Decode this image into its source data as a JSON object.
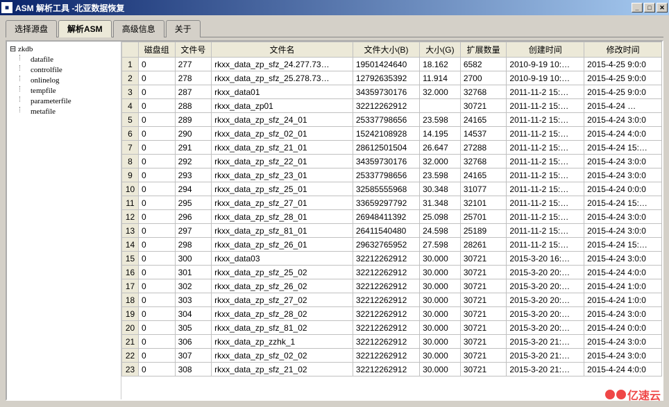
{
  "window": {
    "title": "ASM 解析工具 -北亚数据恢复"
  },
  "tabs": [
    {
      "label": "选择源盘"
    },
    {
      "label": "解析ASM"
    },
    {
      "label": "高级信息"
    },
    {
      "label": "关于"
    }
  ],
  "active_tab_index": 1,
  "tree": {
    "root": "zkdb",
    "children": [
      "datafile",
      "controlfile",
      "onlinelog",
      "tempfile",
      "parameterfile",
      "metafile"
    ]
  },
  "table": {
    "columns": [
      "磁盘组",
      "文件号",
      "文件名",
      "文件大小(B)",
      "大小(G)",
      "扩展数量",
      "创建时间",
      "修改时间"
    ],
    "rows": [
      {
        "n": 1,
        "dg": "0",
        "fno": "277",
        "fname": "rkxx_data_zp_sfz_24.277.73…",
        "fsize": "19501424640",
        "gb": "18.162",
        "ext": "6582",
        "ct": "2010-9-19 10:…",
        "mt": "2015-4-25 9:0:0"
      },
      {
        "n": 2,
        "dg": "0",
        "fno": "278",
        "fname": "rkxx_data_zp_sfz_25.278.73…",
        "fsize": "12792635392",
        "gb": "11.914",
        "ext": "2700",
        "ct": "2010-9-19 10:…",
        "mt": "2015-4-25 9:0:0"
      },
      {
        "n": 3,
        "dg": "0",
        "fno": "287",
        "fname": "rkxx_data01",
        "fsize": "34359730176",
        "gb": "32.000",
        "ext": "32768",
        "ct": "2011-11-2 15:…",
        "mt": "2015-4-25 9:0:0"
      },
      {
        "n": 4,
        "dg": "0",
        "fno": "288",
        "fname": "rkxx_data_zp01",
        "fsize": "32212262912",
        "gb": "",
        "ext": "30721",
        "ct": "2011-11-2 15:…",
        "mt": "2015-4-24 …"
      },
      {
        "n": 5,
        "dg": "0",
        "fno": "289",
        "fname": "rkxx_data_zp_sfz_24_01",
        "fsize": "25337798656",
        "gb": "23.598",
        "ext": "24165",
        "ct": "2011-11-2 15:…",
        "mt": "2015-4-24 3:0:0"
      },
      {
        "n": 6,
        "dg": "0",
        "fno": "290",
        "fname": "rkxx_data_zp_sfz_02_01",
        "fsize": "15242108928",
        "gb": "14.195",
        "ext": "14537",
        "ct": "2011-11-2 15:…",
        "mt": "2015-4-24 4:0:0"
      },
      {
        "n": 7,
        "dg": "0",
        "fno": "291",
        "fname": "rkxx_data_zp_sfz_21_01",
        "fsize": "28612501504",
        "gb": "26.647",
        "ext": "27288",
        "ct": "2011-11-2 15:…",
        "mt": "2015-4-24 15:…"
      },
      {
        "n": 8,
        "dg": "0",
        "fno": "292",
        "fname": "rkxx_data_zp_sfz_22_01",
        "fsize": "34359730176",
        "gb": "32.000",
        "ext": "32768",
        "ct": "2011-11-2 15:…",
        "mt": "2015-4-24 3:0:0"
      },
      {
        "n": 9,
        "dg": "0",
        "fno": "293",
        "fname": "rkxx_data_zp_sfz_23_01",
        "fsize": "25337798656",
        "gb": "23.598",
        "ext": "24165",
        "ct": "2011-11-2 15:…",
        "mt": "2015-4-24 3:0:0"
      },
      {
        "n": 10,
        "dg": "0",
        "fno": "294",
        "fname": "rkxx_data_zp_sfz_25_01",
        "fsize": "32585555968",
        "gb": "30.348",
        "ext": "31077",
        "ct": "2011-11-2 15:…",
        "mt": "2015-4-24 0:0:0"
      },
      {
        "n": 11,
        "dg": "0",
        "fno": "295",
        "fname": "rkxx_data_zp_sfz_27_01",
        "fsize": "33659297792",
        "gb": "31.348",
        "ext": "32101",
        "ct": "2011-11-2 15:…",
        "mt": "2015-4-24 15:…"
      },
      {
        "n": 12,
        "dg": "0",
        "fno": "296",
        "fname": "rkxx_data_zp_sfz_28_01",
        "fsize": "26948411392",
        "gb": "25.098",
        "ext": "25701",
        "ct": "2011-11-2 15:…",
        "mt": "2015-4-24 3:0:0"
      },
      {
        "n": 13,
        "dg": "0",
        "fno": "297",
        "fname": "rkxx_data_zp_sfz_81_01",
        "fsize": "26411540480",
        "gb": "24.598",
        "ext": "25189",
        "ct": "2011-11-2 15:…",
        "mt": "2015-4-24 3:0:0"
      },
      {
        "n": 14,
        "dg": "0",
        "fno": "298",
        "fname": "rkxx_data_zp_sfz_26_01",
        "fsize": "29632765952",
        "gb": "27.598",
        "ext": "28261",
        "ct": "2011-11-2 15:…",
        "mt": "2015-4-24 15:…"
      },
      {
        "n": 15,
        "dg": "0",
        "fno": "300",
        "fname": "rkxx_data03",
        "fsize": "32212262912",
        "gb": "30.000",
        "ext": "30721",
        "ct": "2015-3-20 16:…",
        "mt": "2015-4-24 3:0:0"
      },
      {
        "n": 16,
        "dg": "0",
        "fno": "301",
        "fname": "rkxx_data_zp_sfz_25_02",
        "fsize": "32212262912",
        "gb": "30.000",
        "ext": "30721",
        "ct": "2015-3-20 20:…",
        "mt": "2015-4-24 4:0:0"
      },
      {
        "n": 17,
        "dg": "0",
        "fno": "302",
        "fname": "rkxx_data_zp_sfz_26_02",
        "fsize": "32212262912",
        "gb": "30.000",
        "ext": "30721",
        "ct": "2015-3-20 20:…",
        "mt": "2015-4-24 1:0:0"
      },
      {
        "n": 18,
        "dg": "0",
        "fno": "303",
        "fname": "rkxx_data_zp_sfz_27_02",
        "fsize": "32212262912",
        "gb": "30.000",
        "ext": "30721",
        "ct": "2015-3-20 20:…",
        "mt": "2015-4-24 1:0:0"
      },
      {
        "n": 19,
        "dg": "0",
        "fno": "304",
        "fname": "rkxx_data_zp_sfz_28_02",
        "fsize": "32212262912",
        "gb": "30.000",
        "ext": "30721",
        "ct": "2015-3-20 20:…",
        "mt": "2015-4-24 3:0:0"
      },
      {
        "n": 20,
        "dg": "0",
        "fno": "305",
        "fname": "rkxx_data_zp_sfz_81_02",
        "fsize": "32212262912",
        "gb": "30.000",
        "ext": "30721",
        "ct": "2015-3-20 20:…",
        "mt": "2015-4-24 0:0:0"
      },
      {
        "n": 21,
        "dg": "0",
        "fno": "306",
        "fname": "rkxx_data_zp_zzhk_1",
        "fsize": "32212262912",
        "gb": "30.000",
        "ext": "30721",
        "ct": "2015-3-20 21:…",
        "mt": "2015-4-24 3:0:0"
      },
      {
        "n": 22,
        "dg": "0",
        "fno": "307",
        "fname": "rkxx_data_zp_sfz_02_02",
        "fsize": "32212262912",
        "gb": "30.000",
        "ext": "30721",
        "ct": "2015-3-20 21:…",
        "mt": "2015-4-24 3:0:0"
      },
      {
        "n": 23,
        "dg": "0",
        "fno": "308",
        "fname": "rkxx_data_zp_sfz_21_02",
        "fsize": "32212262912",
        "gb": "30.000",
        "ext": "30721",
        "ct": "2015-3-20 21:…",
        "mt": "2015-4-24 4:0:0"
      }
    ]
  },
  "watermark": "亿速云"
}
